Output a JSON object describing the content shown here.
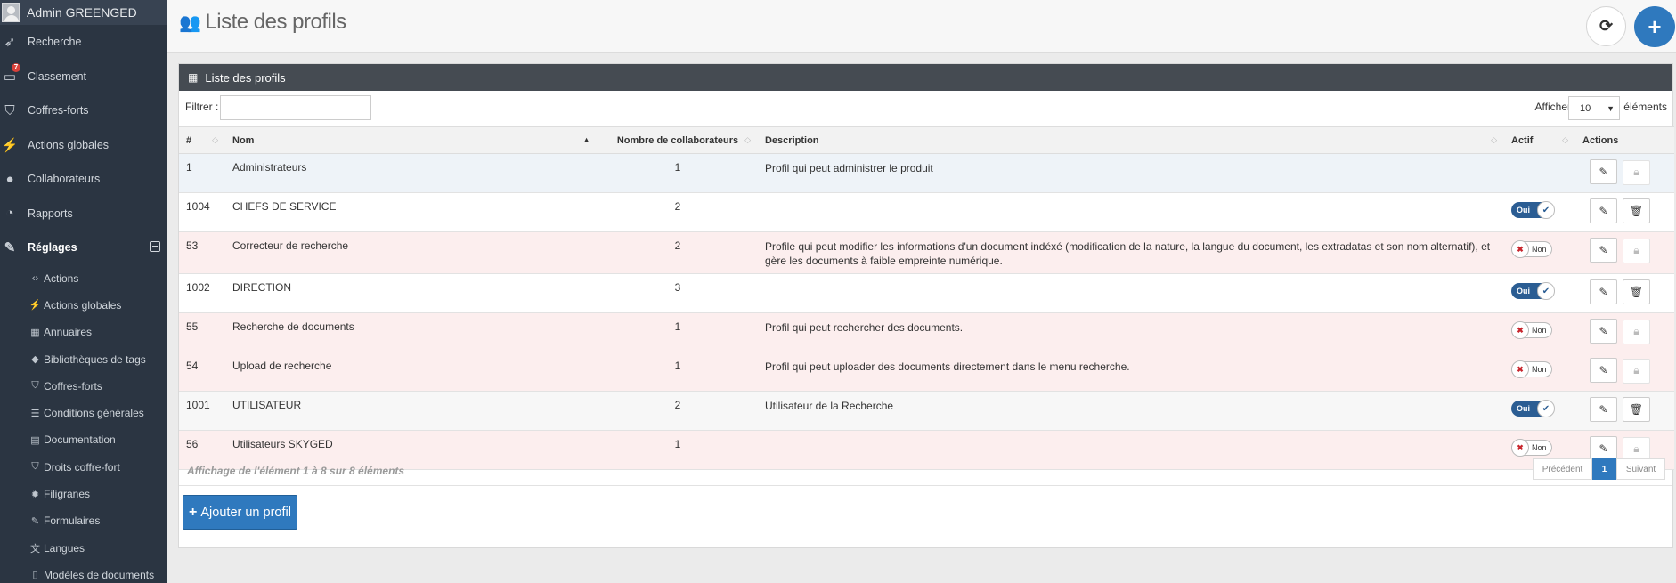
{
  "sidebar": {
    "user_name": "Admin GREENGED",
    "nav": [
      {
        "label": "Recherche",
        "icon": "rocket-icon"
      },
      {
        "label": "Classement",
        "icon": "monitor-icon",
        "badge": "7"
      },
      {
        "label": "Coffres-forts",
        "icon": "shield-icon"
      },
      {
        "label": "Actions globales",
        "icon": "magic-wand-icon"
      },
      {
        "label": "Collaborateurs",
        "icon": "user-icon"
      },
      {
        "label": "Rapports",
        "icon": "dashboard-icon"
      },
      {
        "label": "Réglages",
        "icon": "wrench-icon"
      }
    ],
    "sub": [
      {
        "label": "Actions",
        "icon": "code-icon"
      },
      {
        "label": "Actions globales",
        "icon": "magic-wand-icon"
      },
      {
        "label": "Annuaires",
        "icon": "table-icon"
      },
      {
        "label": "Bibliothèques de tags",
        "icon": "tags-icon"
      },
      {
        "label": "Coffres-forts",
        "icon": "shield-icon"
      },
      {
        "label": "Conditions générales",
        "icon": "list-icon"
      },
      {
        "label": "Documentation",
        "icon": "book-icon"
      },
      {
        "label": "Droits coffre-fort",
        "icon": "shield-icon"
      },
      {
        "label": "Filigranes",
        "icon": "gear-icon"
      },
      {
        "label": "Formulaires",
        "icon": "edit-icon"
      },
      {
        "label": "Langues",
        "icon": "language-icon"
      },
      {
        "label": "Modèles de documents",
        "icon": "file-icon"
      }
    ]
  },
  "header": {
    "title": "Liste des profils"
  },
  "panel": {
    "title": "Liste des profils",
    "filter_label": "Filtrer :",
    "filter_value": "",
    "show_label": "Afficher",
    "show_value": "10",
    "show_suffix": "éléments",
    "columns": [
      "#",
      "Nom",
      "Nombre de collaborateurs",
      "Description",
      "Actif",
      "Actions"
    ],
    "rows": [
      {
        "id": "1",
        "name": "Administrateurs",
        "count": "1",
        "description": "Profil qui peut administrer le produit",
        "active": null
      },
      {
        "id": "1004",
        "name": "CHEFS DE SERVICE",
        "count": "2",
        "description": "",
        "active": "Oui"
      },
      {
        "id": "53",
        "name": "Correcteur de recherche",
        "count": "2",
        "description": "Profile qui peut modifier les informations d'un document indéxé (modification de la nature, la langue du document, les extradatas et son nom alternatif), et gère les documents à faible empreinte numérique.",
        "active": "Non"
      },
      {
        "id": "1002",
        "name": "DIRECTION",
        "count": "3",
        "description": "",
        "active": "Oui"
      },
      {
        "id": "55",
        "name": "Recherche de documents",
        "count": "1",
        "description": "Profil qui peut rechercher des documents.",
        "active": "Non"
      },
      {
        "id": "54",
        "name": "Upload de recherche",
        "count": "1",
        "description": "Profil qui peut uploader des documents directement dans le menu recherche.",
        "active": "Non"
      },
      {
        "id": "1001",
        "name": "UTILISATEUR",
        "count": "2",
        "description": "Utilisateur de la Recherche",
        "active": "Oui"
      },
      {
        "id": "56",
        "name": "Utilisateurs SKYGED",
        "count": "1",
        "description": "",
        "active": "Non"
      }
    ],
    "info": "Affichage de l'élément 1 à 8 sur 8 éléments",
    "pager": {
      "prev": "Précédent",
      "current": "1",
      "next": "Suivant"
    },
    "add_label": "Ajouter un profil"
  },
  "colors": {
    "sidebar_bg": "#2b3542",
    "primary": "#2f79be",
    "panel_header": "#454b52",
    "row_pink": "#fceeee",
    "toggle_on": "#2b5d93"
  }
}
